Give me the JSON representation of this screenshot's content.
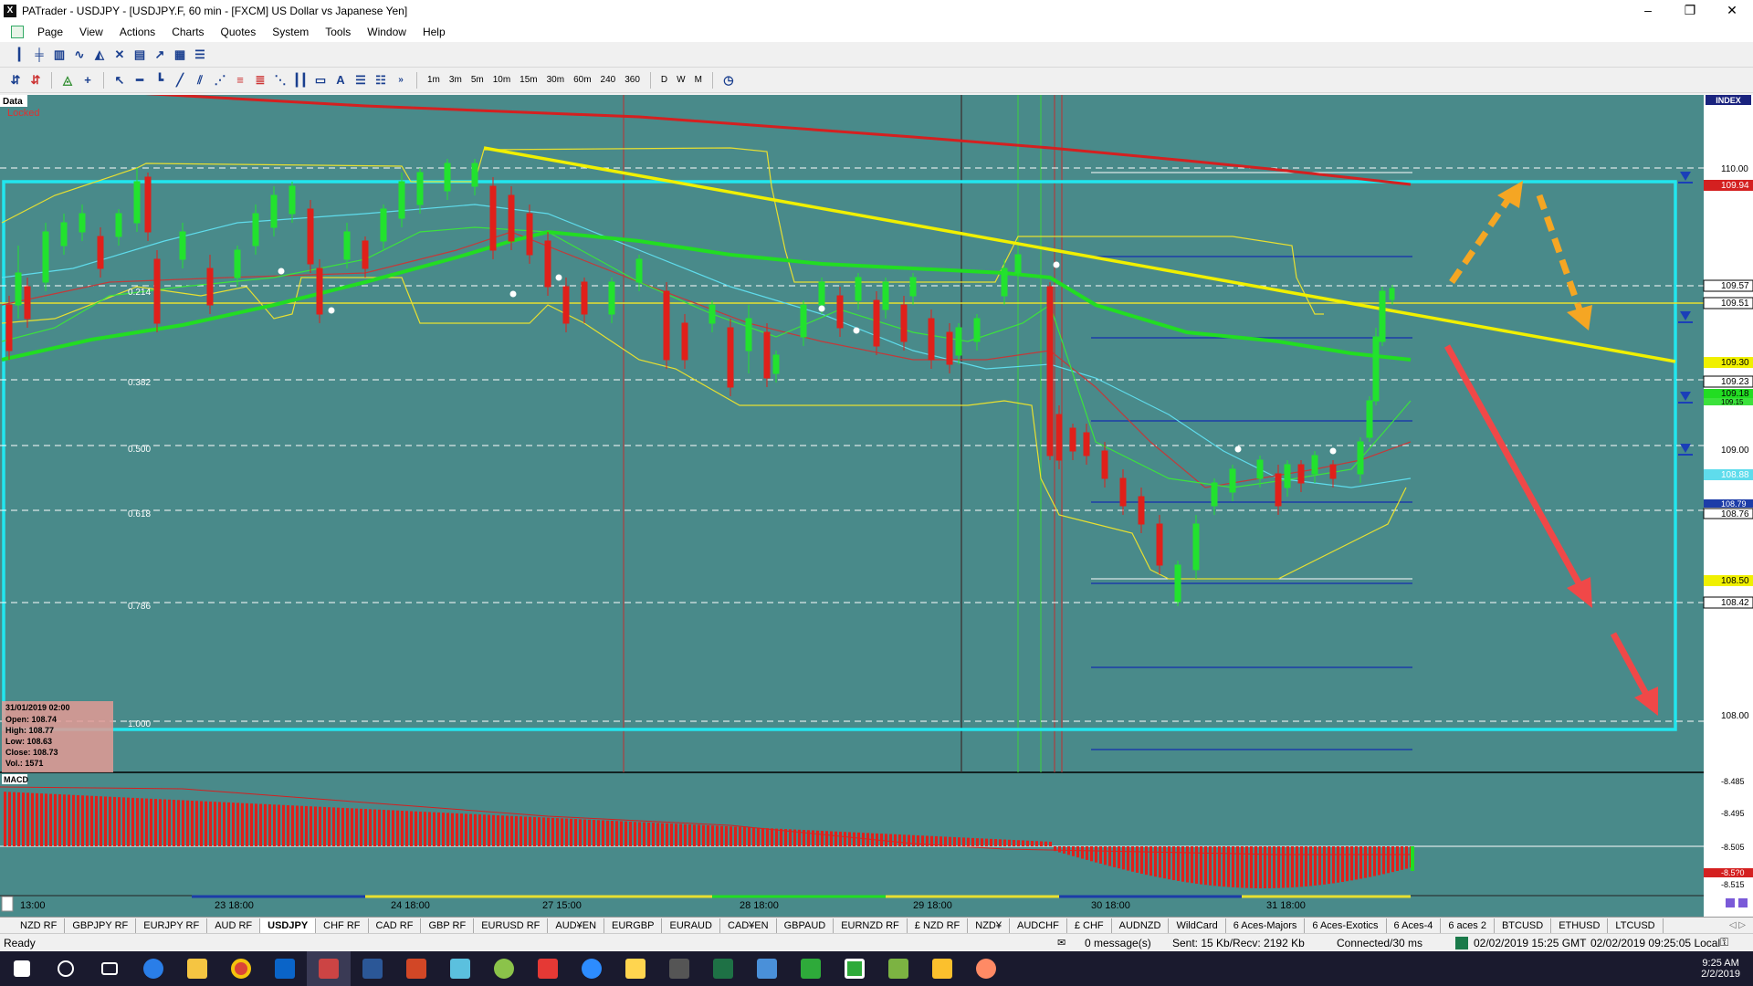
{
  "window": {
    "title": "PATrader - USDJPY - [USDJPY.F, 60 min - [FXCM] US Dollar vs Japanese Yen]",
    "app_icon": "X",
    "controls": [
      "–",
      "❐",
      "✕"
    ]
  },
  "menu": [
    "Page",
    "View",
    "Actions",
    "Charts",
    "Quotes",
    "System",
    "Tools",
    "Window",
    "Help"
  ],
  "timeframes": [
    "1m",
    "3m",
    "5m",
    "10m",
    "15m",
    "30m",
    "60m",
    "240",
    "360",
    "D",
    "W",
    "M"
  ],
  "chart": {
    "data_label": "Data",
    "locked_label": "Locked",
    "index_label": "INDEX",
    "macd_label": "MACD",
    "fib_levels": [
      "0.214",
      "0.382",
      "0.500",
      "0.618",
      "0.786",
      "1.000"
    ],
    "price_axis": [
      "110.00",
      "109.94",
      "109.57",
      "109.51",
      "109.30",
      "109.23",
      "109.18",
      "109.15",
      "109.00",
      "108.88",
      "108.79",
      "108.76",
      "108.50",
      "108.42",
      "108.00"
    ],
    "macd_axis": [
      "-8.485",
      "-8.495",
      "-8.505",
      "-8.5?0",
      "-8.515"
    ],
    "time_axis": [
      "13:00",
      "23 18:00",
      "24 18:00",
      "27 15:00",
      "28 18:00",
      "29 18:00",
      "30 18:00",
      "31 18:00"
    ],
    "info_box": {
      "date": "31/01/2019 02:00",
      "open": "Open: 108.74",
      "high": "High: 108.77",
      "low": "Low: 108.63",
      "close": "Close: 108.73",
      "vol": "Vol.: 1571"
    },
    "colors": {
      "background": "#498a8a",
      "bull_candle": "#22e22e",
      "bear_candle": "#e0201a",
      "ma_green": "#22dd22",
      "trendline": "#f0f000",
      "box": "#22e6ee",
      "ma_red": "#d42020"
    }
  },
  "chart_data": {
    "type": "line",
    "title": "",
    "xlabel": "",
    "ylabel": "",
    "ylim": [
      107.9,
      110.15
    ],
    "x": [
      "23 18:00",
      "24 18:00",
      "27 15:00",
      "28 18:00",
      "29 18:00",
      "30 18:00",
      "31 18:00"
    ],
    "series": [
      {
        "values": [
          109.35,
          109.55,
          109.3,
          109.2,
          109.45,
          108.75,
          109.52
        ]
      }
    ],
    "grid": false
  },
  "tabs": [
    "NZD RF",
    "GBPJPY RF",
    "EURJPY RF",
    "AUD RF",
    "USDJPY",
    "CHF RF",
    "CAD RF",
    "GBP RF",
    "EURUSD RF",
    "AUD¥EN",
    "EURGBP",
    "EURAUD",
    "CAD¥EN",
    "GBPAUD",
    "EURNZD RF",
    "£ NZD RF",
    "NZD¥",
    "AUDCHF",
    "£ CHF",
    "AUDNZD",
    "WildCard",
    "6 Aces-Majors",
    "6 Aces-Exotics",
    "6 Aces-4",
    "6 aces 2",
    "BTCUSD",
    "ETHUSD",
    "LTCUSD"
  ],
  "active_tab": "USDJPY",
  "status": {
    "ready": "Ready",
    "messages": "0 message(s)",
    "traffic": "Sent: 15 Kb/Recv: 2192 Kb",
    "connection": "Connected/30 ms",
    "gmt_time": "02/02/2019 15:25 GMT",
    "local_time": "02/02/2019 09:25:05 Local"
  },
  "taskbar": {
    "clock_time": "9:25 AM",
    "clock_date": "2/2/2019"
  }
}
